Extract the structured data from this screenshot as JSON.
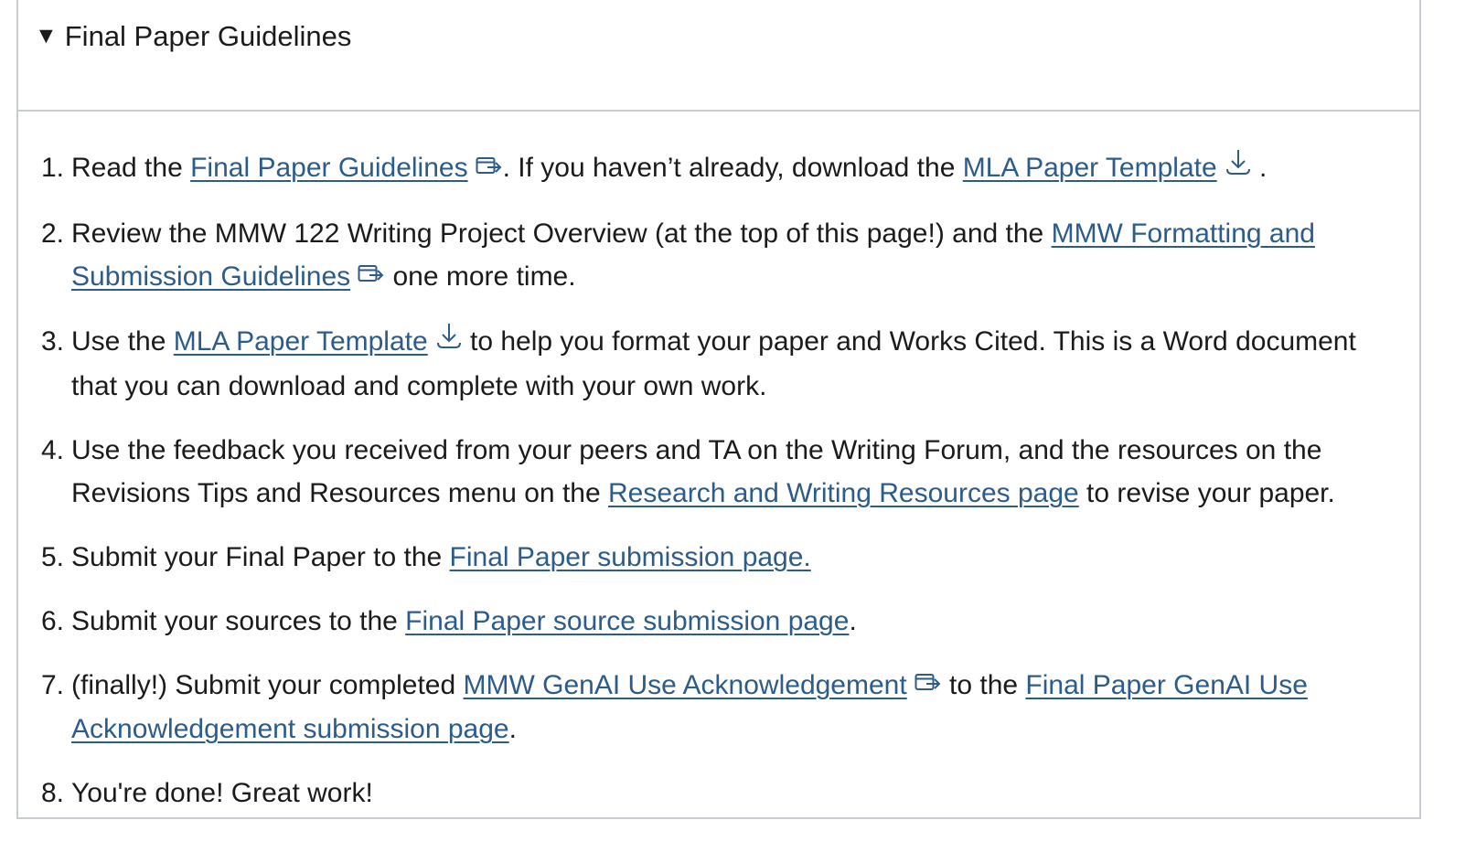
{
  "summary": {
    "label": "Final Paper Guidelines"
  },
  "steps": [
    {
      "num": "1.",
      "a": "Read the ",
      "link1": "Final Paper Guidelines",
      "b": ". If you haven’t already, download the ",
      "link2": "MLA Paper Template",
      "c": " ."
    },
    {
      "num": "2.",
      "a": "Review the MMW 122 Writing Project Overview (at the top of this page!) and the ",
      "link1": "MMW Formatting and Submission Guidelines",
      "b": " one more time."
    },
    {
      "num": "3.",
      "a": "Use the ",
      "link1": "MLA Paper Template",
      "b": " to help you format your paper and Works Cited. This is a Word document that you can download and complete with your own work."
    },
    {
      "num": "4.",
      "a": "Use the feedback you received from your peers and TA on the Writing Forum, and the resources on the Revisions Tips and Resources menu on the ",
      "link1": "Research and Writing Resources page",
      "b": " to revise your paper."
    },
    {
      "num": "5.",
      "a": "Submit your Final Paper to the ",
      "link1": "Final Paper submission page."
    },
    {
      "num": "6.",
      "a": "Submit your sources to the ",
      "link1": "Final Paper source submission page",
      "b": "."
    },
    {
      "num": "7.",
      "a": "(finally!) Submit your completed ",
      "link1": "MMW GenAI Use Acknowledgement",
      "b": " to the ",
      "link2": "Final Paper GenAI Use Acknowledgement submission page",
      "c": "."
    },
    {
      "num": "8.",
      "a": "You're done! Great work!"
    }
  ],
  "icons": {
    "external": "external-link-icon",
    "download": "download-icon"
  },
  "colors": {
    "link": "#2d5b8a",
    "text": "#1b1b1b",
    "border": "#c7cdd1"
  }
}
